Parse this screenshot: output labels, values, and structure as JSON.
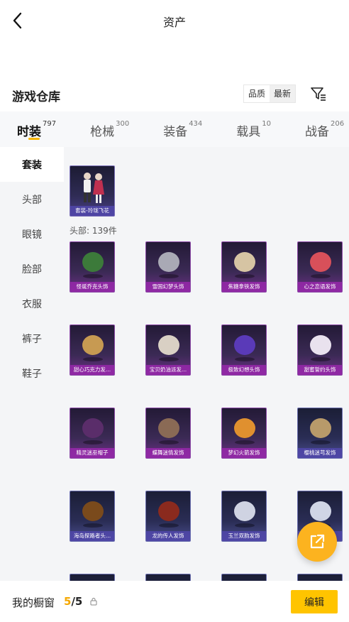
{
  "header": {
    "title": "资产"
  },
  "warehouse": {
    "title": "游戏仓库",
    "sort_options": [
      "品质",
      "最新"
    ],
    "active_sort": 1
  },
  "tabs": [
    {
      "label": "时装",
      "count": "797",
      "active": true
    },
    {
      "label": "枪械",
      "count": "300",
      "active": false
    },
    {
      "label": "装备",
      "count": "434",
      "active": false
    },
    {
      "label": "载具",
      "count": "10",
      "active": false
    },
    {
      "label": "战备",
      "count": "206",
      "active": false
    }
  ],
  "sidebar": {
    "items": [
      "套装",
      "头部",
      "眼镜",
      "脸部",
      "衣服",
      "裤子",
      "鞋子"
    ],
    "active_index": 0
  },
  "suit_items": [
    {
      "name": "套装-玲珑飞花",
      "icon": "character-outfit"
    }
  ],
  "head_section": {
    "label": "头部: 139件"
  },
  "head_items": [
    {
      "name": "怪诞乔克头饰",
      "color": "#3c7a3a"
    },
    {
      "name": "雪国幻梦头饰",
      "color": "#a9a9b5"
    },
    {
      "name": "焦糖拿铁发饰",
      "color": "#d6c4a3"
    },
    {
      "name": "心之恋语发饰",
      "color": "#d8505a"
    },
    {
      "name": "甜心巧克力发...",
      "color": "#c79a52"
    },
    {
      "name": "宝贝奶油派发...",
      "color": "#d9d0c4"
    },
    {
      "name": "极致幻想头饰",
      "color": "#5a3ab8"
    },
    {
      "name": "甜蜜誓约头饰",
      "color": "#e9e2ee"
    },
    {
      "name": "精灵迷巫帽子",
      "color": "#5a2d6a"
    },
    {
      "name": "蝶舞迷情发饰",
      "color": "#8a6a55"
    },
    {
      "name": "梦幻火箭发饰",
      "color": "#e0902f"
    },
    {
      "name": "樱桃迷芎发饰",
      "color": "#b89a6a"
    },
    {
      "name": "海岛探路者头...",
      "color": "#7a4a1c"
    },
    {
      "name": "龙的传人发饰",
      "color": "#8a2a1e"
    },
    {
      "name": "玉兰双韵发饰",
      "color": "#cfd3e2"
    },
    {
      "name": "",
      "color": "#d0d5e5"
    }
  ],
  "bottom": {
    "label": "我的橱窗",
    "used": "5",
    "total": "/5",
    "edit_label": "编辑"
  },
  "colors": {
    "accent": "#ffc400",
    "fab": "#fcb31f",
    "tab_underline": "#f7b500"
  }
}
